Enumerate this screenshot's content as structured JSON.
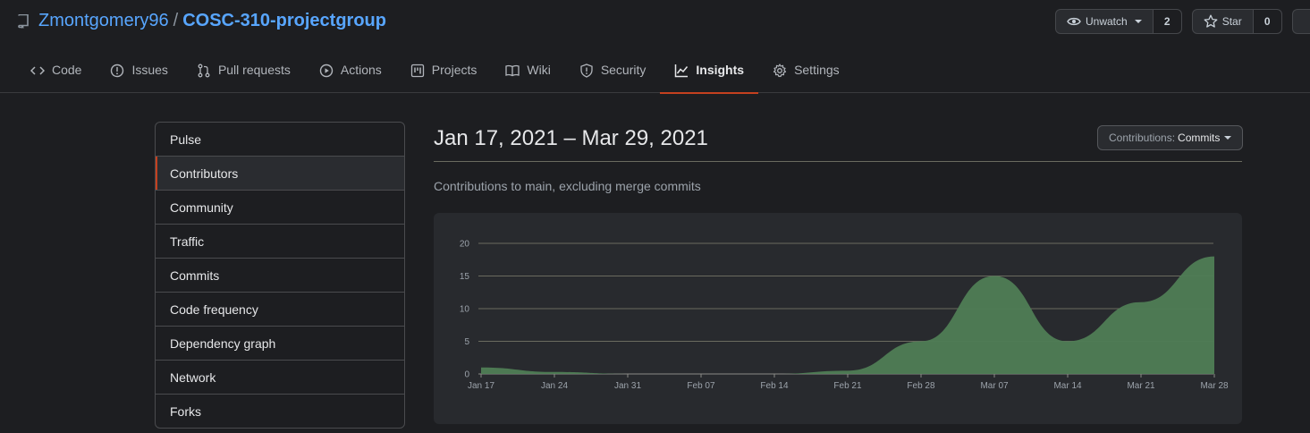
{
  "repo": {
    "owner": "Zmontgomery96",
    "separator": "/",
    "name": "COSC-310-projectgroup"
  },
  "actions": {
    "watch_label": "Unwatch",
    "watch_count": "2",
    "star_label": "Star",
    "star_count": "0"
  },
  "tabs": [
    {
      "label": "Code",
      "icon": "code-icon"
    },
    {
      "label": "Issues",
      "icon": "issue-icon"
    },
    {
      "label": "Pull requests",
      "icon": "pull-request-icon"
    },
    {
      "label": "Actions",
      "icon": "play-icon"
    },
    {
      "label": "Projects",
      "icon": "project-icon"
    },
    {
      "label": "Wiki",
      "icon": "book-icon"
    },
    {
      "label": "Security",
      "icon": "shield-icon"
    },
    {
      "label": "Insights",
      "icon": "graph-icon",
      "selected": true
    },
    {
      "label": "Settings",
      "icon": "gear-icon"
    }
  ],
  "sidebar": {
    "items": [
      {
        "label": "Pulse"
      },
      {
        "label": "Contributors",
        "selected": true
      },
      {
        "label": "Community"
      },
      {
        "label": "Traffic"
      },
      {
        "label": "Commits"
      },
      {
        "label": "Code frequency"
      },
      {
        "label": "Dependency graph"
      },
      {
        "label": "Network"
      },
      {
        "label": "Forks"
      }
    ]
  },
  "main": {
    "date_range": "Jan 17, 2021 – Mar 29, 2021",
    "contrib_label": "Contributions:",
    "contrib_value": "Commits",
    "subtitle": "Contributions to main, excluding merge commits"
  },
  "colors": {
    "accent": "#c4401f",
    "link": "#58a6ff",
    "area_fill": "#4f7d55"
  },
  "chart_data": {
    "type": "area",
    "x_ticks": [
      "Jan 17",
      "Jan 24",
      "Jan 31",
      "Feb 07",
      "Feb 14",
      "Feb 21",
      "Feb 28",
      "Mar 07",
      "Mar 14",
      "Mar 21",
      "Mar 28"
    ],
    "y_ticks": [
      "0",
      "5",
      "10",
      "15",
      "20"
    ],
    "ylim": [
      0,
      20
    ],
    "grid": true,
    "series": [
      {
        "x": [
          "Jan 17",
          "Jan 24",
          "Jan 31",
          "Feb 07",
          "Feb 14",
          "Feb 21",
          "Feb 28",
          "Mar 07",
          "Mar 14",
          "Mar 21",
          "Mar 28"
        ],
        "values": [
          1,
          0.3,
          0,
          0,
          0,
          0.5,
          5,
          15,
          5,
          11,
          18
        ]
      }
    ]
  }
}
